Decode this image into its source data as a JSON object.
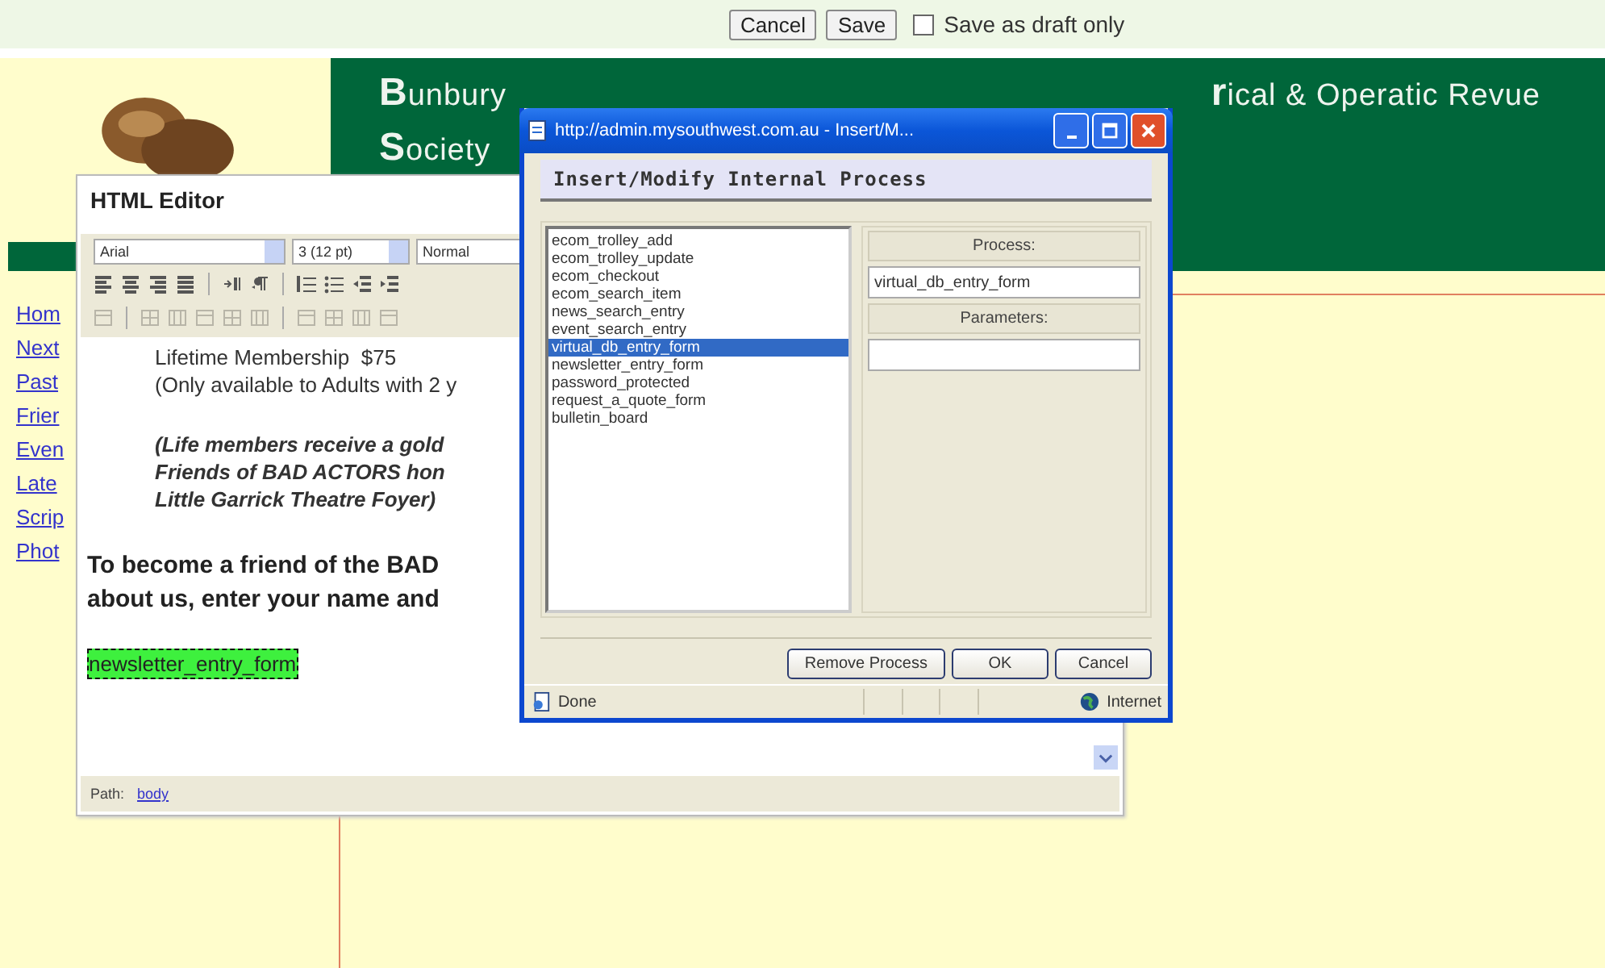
{
  "top_bar": {
    "buttons": [
      "Cancel",
      "Save"
    ],
    "draft_checkbox": {
      "label": "Save as draft only",
      "checked": false
    }
  },
  "header": {
    "title_line_1_start": "Bunbury",
    "title_line_1_end": "rical & Operatic Revue",
    "title_line_2": "Society"
  },
  "nav_links": [
    "Hom",
    "Next",
    "Past",
    "Frier",
    "Even",
    "Late",
    "Scrip",
    "Phot"
  ],
  "html_editor": {
    "title": "HTML Editor",
    "font_select": "Arial",
    "size_select": "3 (12 pt)",
    "format_select": "Normal",
    "toolbar_rows": [
      {
        "disabled": false
      },
      {
        "disabled": true
      }
    ],
    "content": [
      {
        "kind": "plain",
        "lines": [
          "Lifetime Membership  $75",
          "(Only available to Adults with 2 y"
        ]
      },
      {
        "kind": "note",
        "lines": [
          "(Life members receive a gold",
          "Friends of BAD ACTORS hon",
          "Little Garrick Theatre Foyer)"
        ]
      },
      {
        "kind": "lead",
        "lines": [
          "To become a friend of the BAD",
          "about us, enter your name and"
        ]
      },
      {
        "kind": "tag",
        "lines": [
          "newsletter_entry_form"
        ]
      }
    ],
    "path_label": "Path:",
    "path_link": "body"
  },
  "dialog": {
    "title": "http://admin.mysouthwest.com.au - Insert/M...",
    "heading": "Insert/Modify Internal Process",
    "processes": [
      {
        "name": "ecom_trolley_add",
        "selected": false
      },
      {
        "name": "ecom_trolley_update",
        "selected": false
      },
      {
        "name": "ecom_checkout",
        "selected": false
      },
      {
        "name": "ecom_search_item",
        "selected": false
      },
      {
        "name": "news_search_entry",
        "selected": false
      },
      {
        "name": "event_search_entry",
        "selected": false
      },
      {
        "name": "virtual_db_entry_form",
        "selected": true
      },
      {
        "name": "newsletter_entry_form",
        "selected": false
      },
      {
        "name": "password_protected",
        "selected": false
      },
      {
        "name": "request_a_quote_form",
        "selected": false
      },
      {
        "name": "bulletin_board",
        "selected": false
      }
    ],
    "process_label": "Process:",
    "process_value": "virtual_db_entry_form",
    "parameters_label": "Parameters:",
    "buttons": [
      "Remove Process",
      "OK",
      "Cancel"
    ],
    "status_text": "Done",
    "status_zone": "Internet"
  }
}
